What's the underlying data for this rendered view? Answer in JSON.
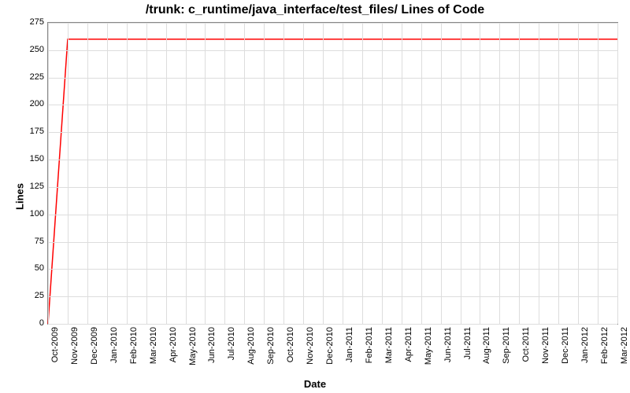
{
  "chart_data": {
    "type": "line",
    "title": "/trunk: c_runtime/java_interface/test_files/ Lines of Code",
    "xlabel": "Date",
    "ylabel": "Lines",
    "ylim": [
      0,
      275
    ],
    "y_ticks": [
      0,
      25,
      50,
      75,
      100,
      125,
      150,
      175,
      200,
      225,
      250,
      275
    ],
    "categories": [
      "Oct-2009",
      "Nov-2009",
      "Dec-2009",
      "Jan-2010",
      "Feb-2010",
      "Mar-2010",
      "Apr-2010",
      "May-2010",
      "Jun-2010",
      "Jul-2010",
      "Aug-2010",
      "Sep-2010",
      "Oct-2010",
      "Nov-2010",
      "Dec-2010",
      "Jan-2011",
      "Feb-2011",
      "Mar-2011",
      "Apr-2011",
      "May-2011",
      "Jun-2011",
      "Jul-2011",
      "Aug-2011",
      "Sep-2011",
      "Oct-2011",
      "Nov-2011",
      "Dec-2011",
      "Jan-2012",
      "Feb-2012",
      "Mar-2012"
    ],
    "series": [
      {
        "name": "Lines of Code",
        "color": "#ff0000",
        "values": [
          0,
          260,
          260,
          260,
          260,
          260,
          260,
          260,
          260,
          260,
          260,
          260,
          260,
          260,
          260,
          260,
          260,
          260,
          260,
          260,
          260,
          260,
          260,
          260,
          260,
          260,
          260,
          260,
          260,
          260
        ]
      }
    ]
  }
}
